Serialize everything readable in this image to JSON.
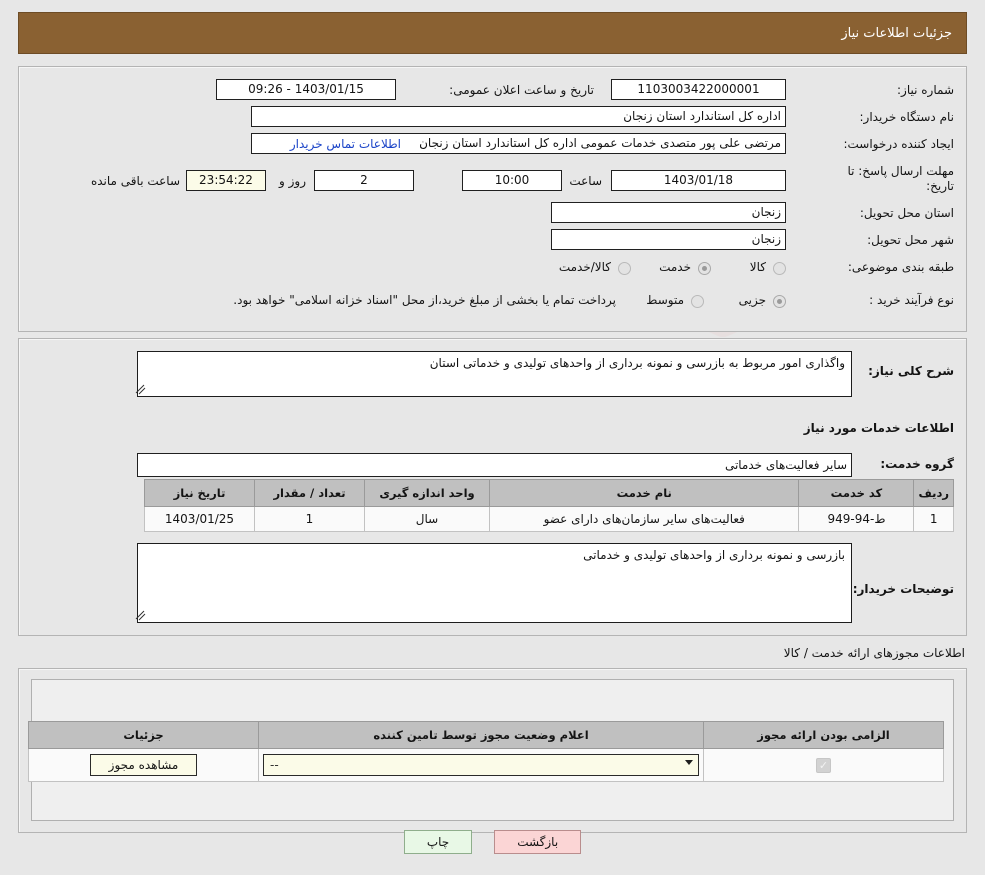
{
  "window": {
    "title": "جزئیات اطلاعات نیاز",
    "title_bg": "#8a6132"
  },
  "watermark": {
    "text_left": "AriaTender",
    "text_right": ".net"
  },
  "main": {
    "need_number_label": "شماره نیاز:",
    "need_number_value": "1103003422000001",
    "announce_datetime_label": "تاریخ و ساعت اعلان عمومی:",
    "announce_datetime_value": "1403/01/15 - 09:26",
    "buyer_org_label": "نام دستگاه خریدار:",
    "buyer_org_value": "اداره کل استاندارد استان زنجان",
    "requester_label": "ایجاد کننده درخواست:",
    "requester_value": "مرتضی علی پور متصدی خدمات عمومی اداره کل استاندارد استان زنجان",
    "contact_link": "اطلاعات تماس خریدار",
    "deadline_label": "مهلت ارسال پاسخ: تا تاریخ:",
    "deadline_date": "1403/01/18",
    "hour_label": "ساعت",
    "deadline_time": "10:00",
    "days_remaining": "2",
    "days_word": "روز و",
    "countdown": "23:54:22",
    "countdown_suffix": "ساعت باقی مانده",
    "province_label": "استان محل تحویل:",
    "province_value": "زنجان",
    "city_label": "شهر محل تحویل:",
    "city_value": "زنجان",
    "category_label": "طبقه بندی موضوعی:",
    "category_options": [
      {
        "label": "کالا",
        "selected": false
      },
      {
        "label": "خدمت",
        "selected": true
      },
      {
        "label": "کالا/خدمت",
        "selected": false
      }
    ],
    "process_label": "نوع فرآیند خرید :",
    "process_options": [
      {
        "label": "جزیی",
        "selected": true
      },
      {
        "label": "متوسط",
        "selected": false
      }
    ],
    "payment_note": "پرداخت تمام یا بخشی از مبلغ خرید،از محل \"اسناد خزانه اسلامی\" خواهد بود."
  },
  "description": {
    "summary_label": "شرح کلی نیاز:",
    "summary_value": "واگذاری امور مربوط به بازرسی و نمونه برداری از واحدهای تولیدی و خدماتی استان",
    "services_heading": "اطلاعات خدمات مورد نیاز",
    "service_group_label": "گروه خدمت:",
    "service_group_value": "سایر فعالیت‌های خدماتی",
    "table": {
      "headers": [
        "ردیف",
        "کد خدمت",
        "نام خدمت",
        "واحد اندازه گیری",
        "تعداد / مقدار",
        "تاریخ نیاز"
      ],
      "rows": [
        [
          "1",
          "ط-94-949",
          "فعالیت‌های سایر سازمان‌های دارای عضو",
          "سال",
          "1",
          "1403/01/25"
        ]
      ]
    },
    "buyer_notes_label": "توضیحات خریدار:",
    "buyer_notes_value": "بازرسی و نمونه برداری از واحدهای تولیدی و خدماتی"
  },
  "permits": {
    "heading": "اطلاعات مجوزهای ارائه خدمت / کالا",
    "headers": [
      "الزامی بودن ارائه مجوز",
      "اعلام وضعیت مجوز توسط تامین کننده",
      "جزئیات"
    ],
    "rows": [
      {
        "required_checked": true,
        "status_value": "--",
        "details_button": "مشاهده مجوز"
      }
    ]
  },
  "footer": {
    "print_label": "چاپ",
    "back_label": "بازگشت"
  }
}
